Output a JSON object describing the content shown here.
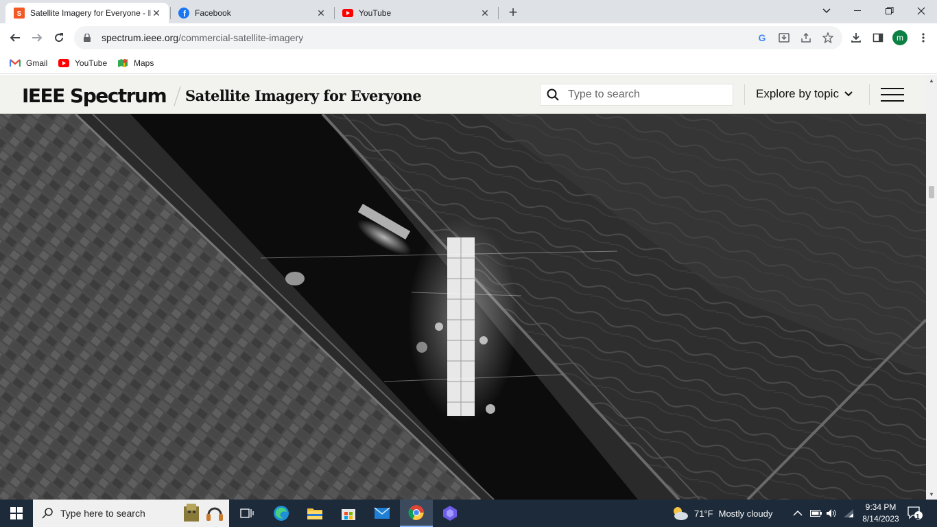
{
  "browser": {
    "tabs": [
      {
        "title": "Satellite Imagery for Everyone - IE",
        "favicon": "ieee-spectrum-favicon",
        "active": true
      },
      {
        "title": "Facebook",
        "favicon": "facebook-favicon",
        "active": false
      },
      {
        "title": "YouTube",
        "favicon": "youtube-favicon",
        "active": false
      }
    ],
    "close_symbol": "✕",
    "new_tab_symbol": "+",
    "url_host": "spectrum.ieee.org",
    "url_path": "/commercial-satellite-imagery",
    "profile_initial": "m",
    "bookmarks": [
      {
        "label": "Gmail",
        "icon": "gmail-icon"
      },
      {
        "label": "YouTube",
        "icon": "youtube-icon"
      },
      {
        "label": "Maps",
        "icon": "maps-icon"
      }
    ]
  },
  "site": {
    "logo": "IEEE Spectrum",
    "page_title": "Satellite Imagery for Everyone",
    "search_placeholder": "Type to search",
    "explore_label": "Explore by topic"
  },
  "hero": {
    "description_icon": "satellite-radar-image"
  },
  "taskbar": {
    "search_placeholder": "Type here to search",
    "weather_temp": "71°F",
    "weather_text": "Mostly cloudy",
    "time": "9:34 PM",
    "date": "8/14/2023",
    "notification_count": "1"
  },
  "colors": {
    "tabstrip": "#dee1e6",
    "site_header": "#f2f2ee",
    "taskbar": "#1c2a3a",
    "brand_orange": "#f15a24"
  }
}
